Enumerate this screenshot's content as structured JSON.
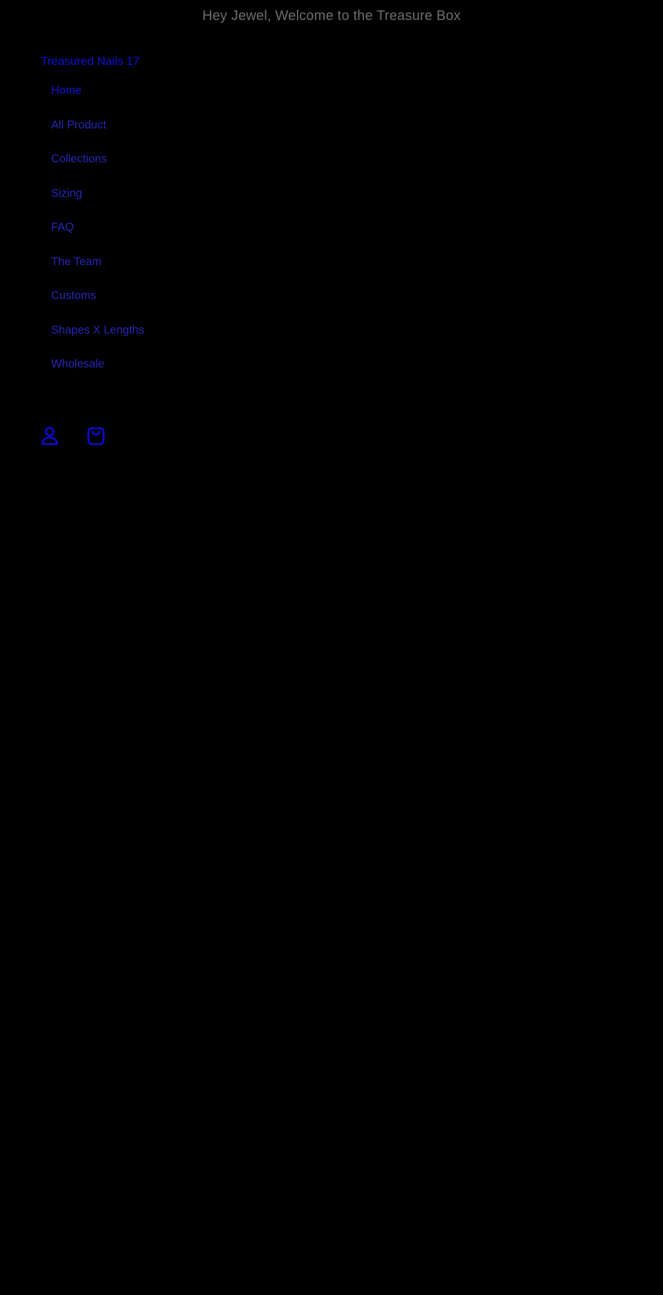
{
  "announcement": {
    "text": "Hey Jewel, Welcome to the Treasure Box"
  },
  "header": {
    "brand": "Treasured Nails 17",
    "account_icon": "user-icon",
    "cart_icon": "shopping-bag-icon"
  },
  "nav": {
    "items": [
      {
        "label": "Home",
        "active": true
      },
      {
        "label": "All Product"
      },
      {
        "label": "Collections"
      },
      {
        "label": "Sizing"
      },
      {
        "label": "FAQ"
      },
      {
        "label": "The Team"
      },
      {
        "label": "Customs"
      },
      {
        "label": "Shapes X Lengths"
      },
      {
        "label": "Wholesale"
      }
    ]
  },
  "colors": {
    "background": "#000000",
    "announcement_text": "#6d6d6d",
    "link": "#2626b8",
    "brand": "#1010d8",
    "icon": "#0b0be0"
  }
}
